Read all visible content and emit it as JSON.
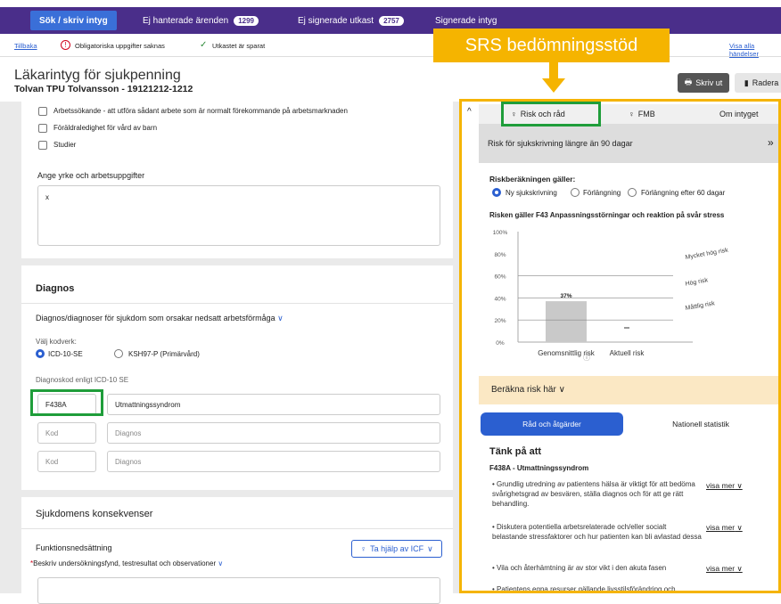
{
  "topnav": {
    "tabs": [
      {
        "label": "Sök / skriv intyg"
      },
      {
        "label": "Ej hanterade ärenden",
        "count": "1299"
      },
      {
        "label": "Ej signerade utkast",
        "count": "2757"
      },
      {
        "label": "Signerade intyg"
      }
    ]
  },
  "subbar": {
    "back": "Tillbaka",
    "warning": "Obligatoriska uppgifter saknas",
    "saved": "Utkastet är sparat",
    "events": "Visa alla händelser"
  },
  "header": {
    "title": "Läkarintyg för sjukpenning",
    "patient": "Tolvan TPU Tolvansson - 19121212-1212",
    "print": "Skriv ut",
    "delete": "Radera"
  },
  "form": {
    "checkboxes": [
      "Arbetssökande - att utföra sådant arbete som är normalt förekommande på arbetsmarknaden",
      "Föräldraledighet för vård av barn",
      "Studier"
    ],
    "occupation_label": "Ange yrke och arbetsuppgifter",
    "occupation_value": "x",
    "diagnosis_title": "Diagnos",
    "diagnosis_question": "Diagnos/diagnoser för sjukdom som orsakar nedsatt arbetsförmåga",
    "codesystem_label": "Välj kodverk:",
    "codesystem_options": [
      "ICD-10-SE",
      "KSH97-P (Primärvård)"
    ],
    "code_label": "Diagnoskod enligt ICD-10 SE",
    "rows": [
      {
        "code": "F438A",
        "diagnosis": "Utmattningssyndrom"
      },
      {
        "code": "Kod",
        "diagnosis": "Diagnos"
      },
      {
        "code": "Kod",
        "diagnosis": "Diagnos"
      }
    ],
    "consequences_title": "Sjukdomens konsekvenser",
    "function_label": "Funktionsnedsättning",
    "icf_button": "Ta hjälp av ICF",
    "findings_label": "Beskriv undersökningsfynd, testresultat och observationer",
    "required_mark": "*"
  },
  "srs": {
    "callout": "SRS bedömningsstöd",
    "tabs": [
      "Risk och råd",
      "FMB",
      "Om intyget"
    ],
    "risk_header": "Risk för sjukskrivning längre än 90 dagar",
    "calc_label": "Riskberäkningen gäller:",
    "calc_options": [
      "Ny sjukskrivning",
      "Förlängning",
      "Förlängning efter 60 dagar"
    ],
    "risk_for": "Risken gäller F43 Anpassningsstörningar och reaktion på svår stress",
    "calc_risk": "Beräkna risk här",
    "advice_button": "Råd och åtgärder",
    "stats_button": "Nationell statistik",
    "think_title": "Tänk på att",
    "think_subtitle": "F438A - Utmattningssyndrom",
    "tips": [
      "Grundlig utredning av patientens hälsa är viktigt för att bedöma svårighetsgrad av besvären, ställa diagnos och för att ge rätt behandling.",
      "Diskutera potentiella arbetsrelaterade och/eller socialt belastande stressfaktorer och hur patienten kan bli avlastad dessa",
      "Vila och återhämtning är av stor vikt i den akuta fasen",
      "Patientens egna resurser gällande livsstilsförändring och"
    ],
    "see_more": "visa mer"
  },
  "chart_data": {
    "type": "bar",
    "categories": [
      "Genomsnittlig risk",
      "Aktuell risk"
    ],
    "values": [
      37,
      0
    ],
    "value_labels": [
      "37%",
      ""
    ],
    "yticks": [
      "0%",
      "20%",
      "40%",
      "60%",
      "80%",
      "100%"
    ],
    "ylim": [
      0,
      100
    ],
    "zones": [
      "Måttlig risk",
      "Hög risk",
      "Mycket hög risk"
    ],
    "grid": true,
    "colors": {
      "bar": "#c9c9c9",
      "zone_line": "#888888"
    }
  },
  "colors": {
    "nav": "#4a2e8a",
    "active_tab": "#3a6fd8",
    "highlight_green": "#1f9d3a",
    "highlight_orange": "#f5b400",
    "warning": "#d0021b",
    "saved": "#2e8b3a",
    "calc_band": "#fbe8c4"
  },
  "icons": [
    "arrow-left-icon",
    "warning-icon",
    "check-icon",
    "printer-icon",
    "trash-icon",
    "lightbulb-icon",
    "chevron-down-icon",
    "chevron-up-icon",
    "double-chevron-icon",
    "info-icon"
  ]
}
